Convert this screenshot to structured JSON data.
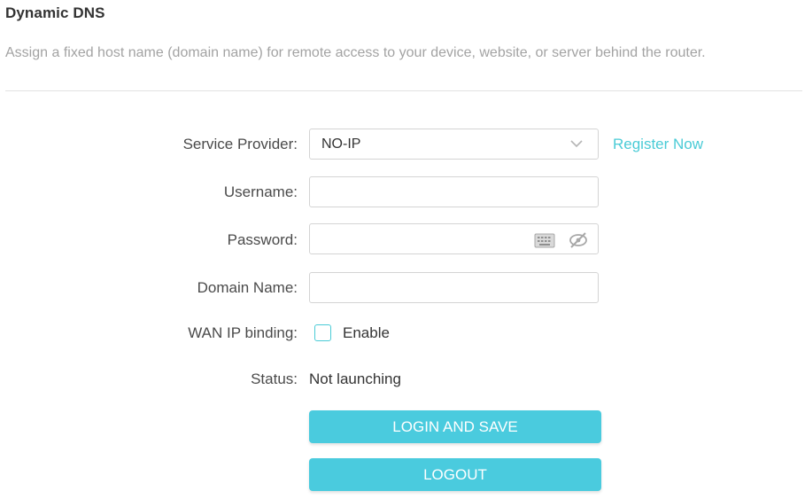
{
  "header": {
    "title": "Dynamic DNS",
    "description": "Assign a fixed host name (domain name) for remote access to your device, website, or server behind the router."
  },
  "form": {
    "service_provider": {
      "label": "Service Provider:",
      "selected": "NO-IP",
      "link": "Register Now"
    },
    "username": {
      "label": "Username:",
      "value": ""
    },
    "password": {
      "label": "Password:",
      "value": ""
    },
    "domain_name": {
      "label": "Domain Name:",
      "value": ""
    },
    "wan_ip_binding": {
      "label": "WAN IP binding:",
      "option": "Enable",
      "checked": false
    },
    "status": {
      "label": "Status:",
      "value": "Not launching"
    }
  },
  "actions": {
    "login_save_label": "LOGIN AND SAVE",
    "logout_label": "LOGOUT"
  },
  "colors": {
    "accent": "#4acbde",
    "link": "#4acbd6",
    "description": "#a3a3a3"
  },
  "icons": {
    "dropdown": "chevron-down-icon",
    "keyboard": "keyboard-icon",
    "visibility": "eye-off-icon"
  }
}
